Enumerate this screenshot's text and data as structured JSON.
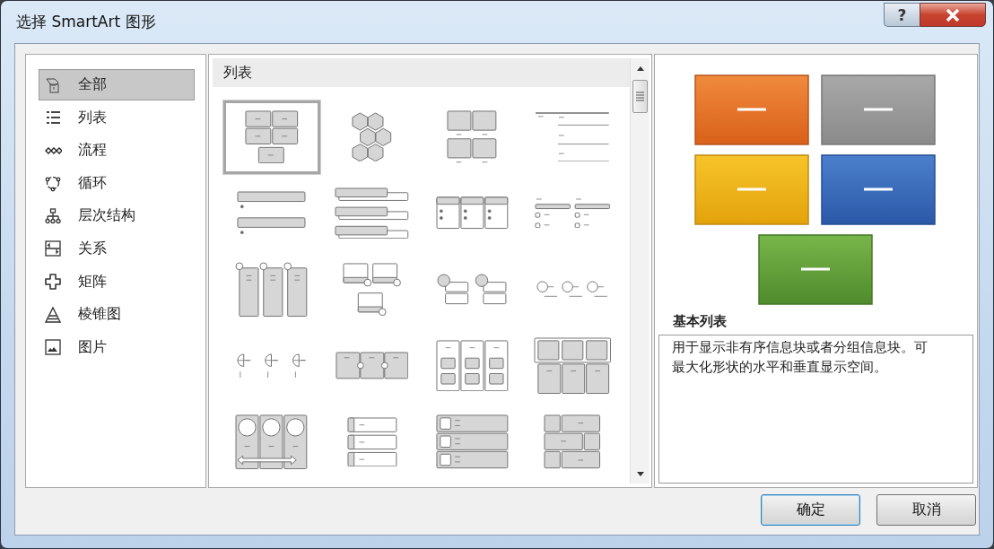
{
  "window": {
    "title": "选择 SmartArt 图形",
    "help_button": "?"
  },
  "sidebar": {
    "items": [
      {
        "label": "全部",
        "kind": "all",
        "selected": true
      },
      {
        "label": "列表",
        "kind": "list",
        "selected": false
      },
      {
        "label": "流程",
        "kind": "process",
        "selected": false
      },
      {
        "label": "循环",
        "kind": "cycle",
        "selected": false
      },
      {
        "label": "层次结构",
        "kind": "hierarchy",
        "selected": false
      },
      {
        "label": "关系",
        "kind": "relationship",
        "selected": false
      },
      {
        "label": "矩阵",
        "kind": "matrix",
        "selected": false
      },
      {
        "label": "棱锥图",
        "kind": "pyramid",
        "selected": false
      },
      {
        "label": "图片",
        "kind": "picture",
        "selected": false
      }
    ]
  },
  "gallery": {
    "heading": "列表",
    "items": [
      {
        "kind": "block-grid",
        "selected": true
      },
      {
        "kind": "hexagons",
        "selected": false
      },
      {
        "kind": "captioned-blocks",
        "selected": false
      },
      {
        "kind": "lined-list",
        "selected": false
      },
      {
        "kind": "bar-list",
        "selected": false
      },
      {
        "kind": "stacked-tabs",
        "selected": false
      },
      {
        "kind": "table-columns",
        "selected": false
      },
      {
        "kind": "tabbed-bullets",
        "selected": false
      },
      {
        "kind": "pinned-columns",
        "selected": false
      },
      {
        "kind": "picture-callouts",
        "selected": false
      },
      {
        "kind": "circle-callouts",
        "selected": false
      },
      {
        "kind": "circle-timeline",
        "selected": false
      },
      {
        "kind": "half-circles",
        "selected": false
      },
      {
        "kind": "linked-blocks",
        "selected": false
      },
      {
        "kind": "column-boxes",
        "selected": false
      },
      {
        "kind": "framed-grid",
        "selected": false
      },
      {
        "kind": "circle-columns-arrow",
        "selected": false
      },
      {
        "kind": "tab-rows",
        "selected": false
      },
      {
        "kind": "picture-rows",
        "selected": false
      },
      {
        "kind": "brick-grid",
        "selected": false
      }
    ]
  },
  "preview": {
    "title": "基本列表",
    "description": "用于显示非有序信息块或者分组信息块。可最大化形状的水平和垂直显示空间。"
  },
  "buttons": [
    {
      "label": "确定",
      "default": true
    },
    {
      "label": "取消",
      "default": false
    }
  ]
}
